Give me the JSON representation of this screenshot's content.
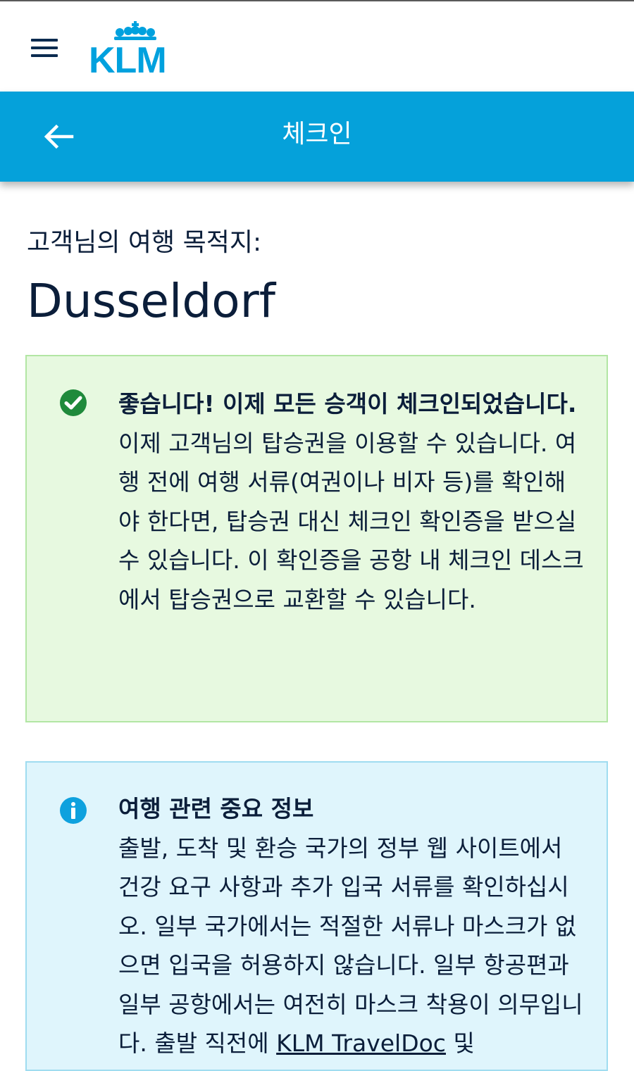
{
  "topbar": {
    "menu_icon": "hamburger-menu-icon",
    "logo": {
      "text": "KLM",
      "crown_icon": "klm-crown-icon",
      "color": "#00a1de"
    }
  },
  "header": {
    "title": "체크인",
    "back_icon": "arrow-left-icon",
    "background": "#05a1da"
  },
  "destination": {
    "label": "고객님의 여행 목적지:",
    "city": "Dusseldorf"
  },
  "success_notice": {
    "icon": "check-circle-icon",
    "title": "좋습니다! 이제 모든 승객이 체크인되었습니다.",
    "body": "이제 고객님의 탑승권을 이용할 수 있습니다. 여행 전에 여행 서류(여권이나 비자 등)를 확인해야 한다면, 탑승권 대신 체크인 확인증을 받으실 수 있습니다. 이 확인증을 공항 내 체크인 데스크에서 탑승권으로 교환할 수 있습니다.",
    "background": "#e7f9e0",
    "accent": "#1f8a3b"
  },
  "info_notice": {
    "icon": "info-circle-icon",
    "title": "여행 관련 중요 정보",
    "body_before_link": "출발, 도착 및 환승 국가의 정부 웹 사이트에서 건강 요구 사항과 추가 입국 서류를 확인하십시오. 일부 국가에서는 적절한 서류나 마스크가 없으면 입국을 허용하지 않습니다. 일부 항공편과 일부 공항에서는 여전히 마스크 착용이 의무입니다. 출발 직전에 ",
    "link_text": "KLM TravelDoc",
    "body_after_link": " 및",
    "background": "#dff5fc",
    "accent": "#0ea1de"
  }
}
